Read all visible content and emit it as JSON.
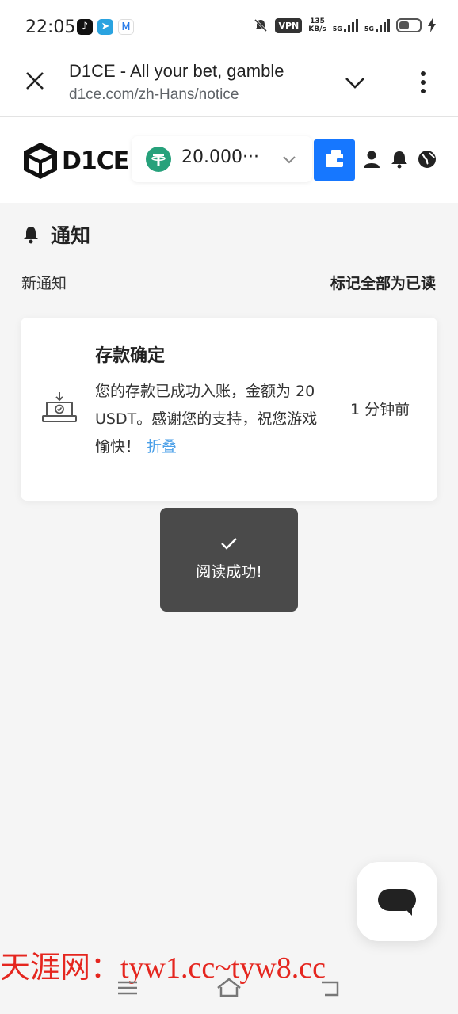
{
  "status_bar": {
    "time": "22:05",
    "vpn": "VPN",
    "net_speed": "135",
    "net_unit": "KB/s",
    "sim1": "5G",
    "sim2": "5G",
    "apps": [
      "tiktok-icon",
      "telegram-icon",
      "gmail-icon"
    ]
  },
  "browser": {
    "page_title": "D1CE - All your bet, gamble",
    "url": "d1ce.com/zh-Hans/notice"
  },
  "site_header": {
    "logo_text": "D1CE",
    "balance": "20.000···",
    "accent": "#1677ff",
    "tether_color": "#26a17b"
  },
  "notice": {
    "title": "通知",
    "new_label": "新通知",
    "mark_all_read": "标记全部为已读",
    "card": {
      "title": "存款确定",
      "body": "您的存款已成功入账，金额为 20 USDT。感谢您的支持，祝您游戏愉快！",
      "collapse": "折叠",
      "time": "1 分钟前"
    }
  },
  "toast": {
    "message": "阅读成功!"
  },
  "watermark": "天涯网：tyw1.cc~tyw8.cc"
}
